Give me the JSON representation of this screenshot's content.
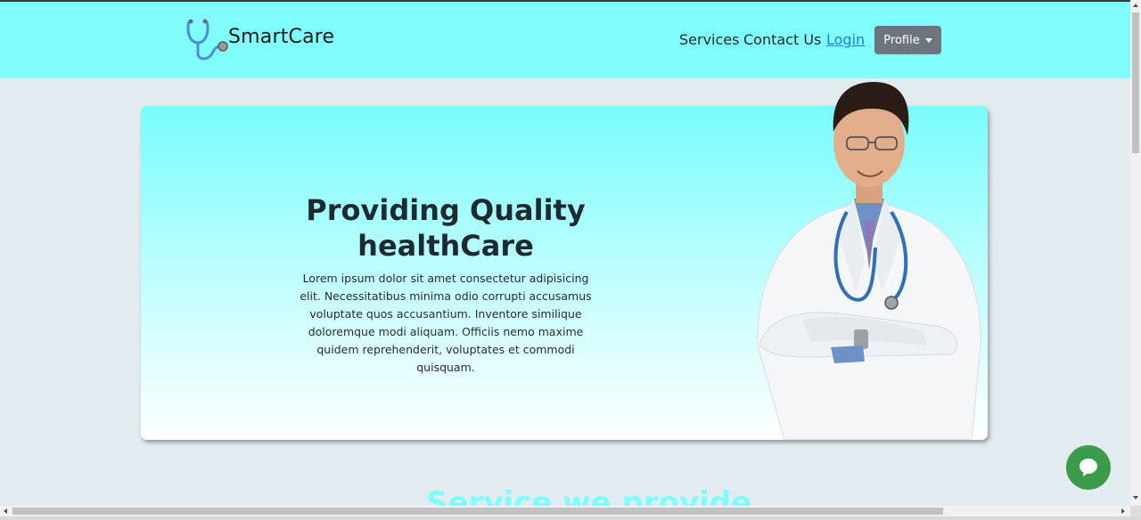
{
  "navbar": {
    "brand": "SmartCare",
    "links": {
      "services": "Services",
      "contact": "Contact Us",
      "login": "Login"
    },
    "profile_label": "Profile"
  },
  "hero": {
    "title_line1": "Providing Quality",
    "title_line2": "healthCare",
    "text": "Lorem ipsum dolor sit amet consectetur adipisicing elit. Necessitatibus minima odio corrupti accusamus voluptate quos accusantium. Inventore similique doloremque modi aliquam. Officiis nemo maxime quidem reprehenderit, voluptates et commodi quisquam."
  },
  "services_heading": "Service we provide",
  "icons": [
    "stethoscope-icon",
    "caret-down-icon",
    "chat-bubble-icon"
  ],
  "colors": {
    "navbar_bg": "#7ffdfd",
    "page_bg": "#e2ebef",
    "profile_button": "#6c757d",
    "chat_button": "#3a9b4a",
    "link": "#1e7be0"
  }
}
